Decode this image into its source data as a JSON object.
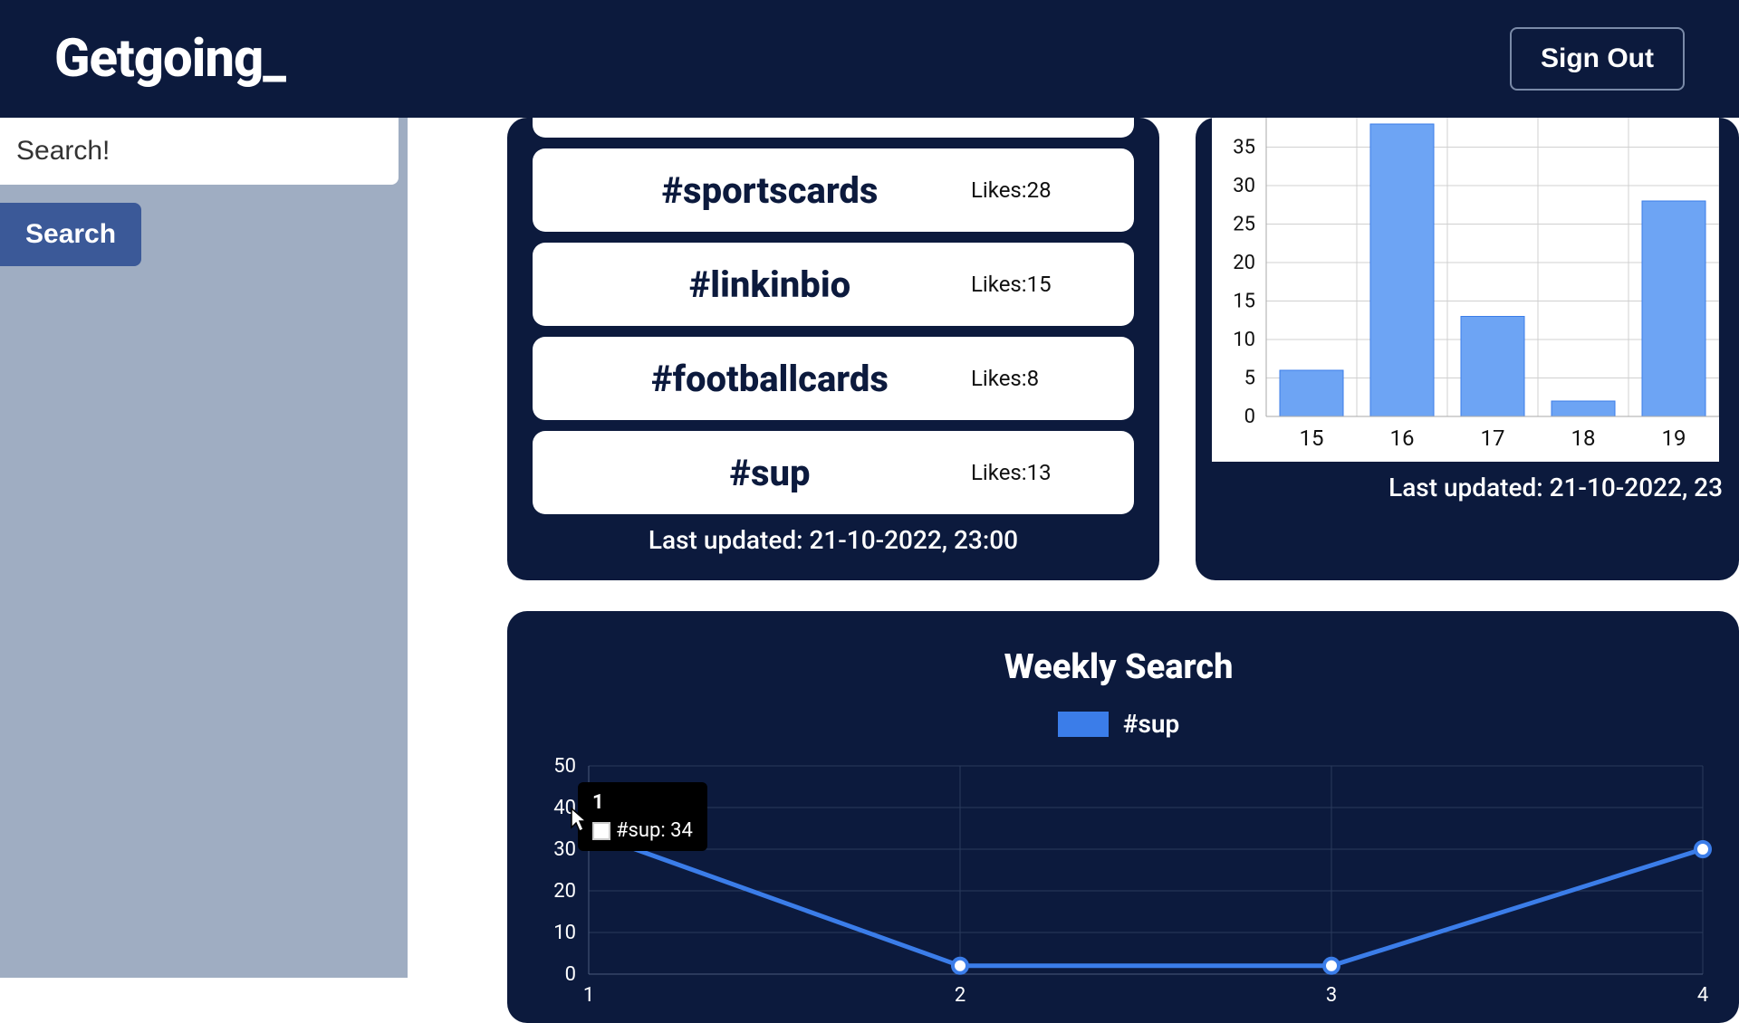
{
  "header": {
    "logo": "Getgoing_",
    "signout": "Sign Out"
  },
  "sidebar": {
    "search_placeholder": "Search!",
    "search_button": "Search"
  },
  "hashtag_panel": {
    "items": [
      {
        "tag": "#sportscards",
        "likes_label": "Likes:28"
      },
      {
        "tag": "#linkinbio",
        "likes_label": "Likes:15"
      },
      {
        "tag": "#footballcards",
        "likes_label": "Likes:8"
      },
      {
        "tag": "#sup",
        "likes_label": "Likes:13"
      }
    ],
    "footer": "Last updated: 21-10-2022, 23:00"
  },
  "bar_panel": {
    "footer": "Last updated: 21-10-2022, 23"
  },
  "line_panel": {
    "title": "Weekly Search",
    "legend_label": "#sup",
    "tooltip_index": "1",
    "tooltip_value": "#sup: 34"
  },
  "chart_data": [
    {
      "type": "bar",
      "categories": [
        "15",
        "16",
        "17",
        "18",
        "19"
      ],
      "values": [
        6,
        38,
        13,
        2,
        28
      ],
      "ylabel": "",
      "xlabel": "",
      "ylim": [
        0,
        40
      ],
      "yticks": [
        0,
        5,
        10,
        15,
        20,
        25,
        30,
        35,
        40
      ]
    },
    {
      "type": "line",
      "title": "Weekly Search",
      "series": [
        {
          "name": "#sup",
          "values": [
            34,
            2,
            2,
            30
          ]
        }
      ],
      "x": [
        "1",
        "2",
        "3",
        "4"
      ],
      "ylim": [
        0,
        50
      ],
      "yticks": [
        0,
        10,
        20,
        30,
        40,
        50
      ],
      "tooltip": {
        "x": "1",
        "series": "#sup",
        "value": 34
      }
    }
  ]
}
